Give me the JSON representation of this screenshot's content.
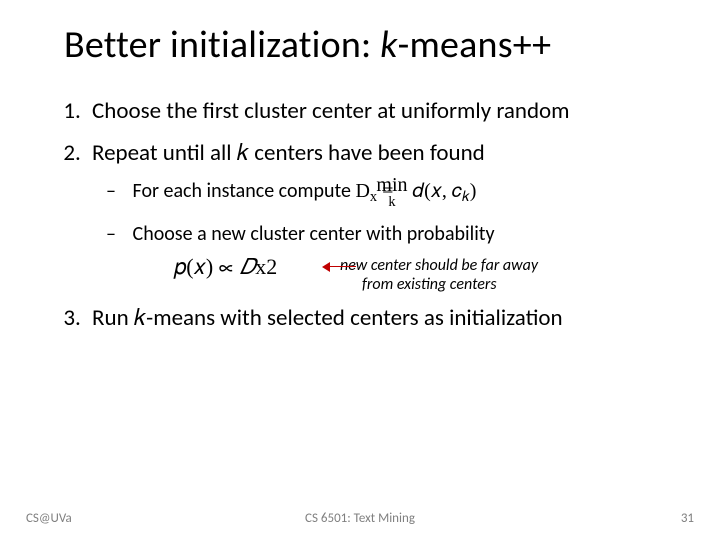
{
  "title_prefix": "Better initialization: ",
  "title_k": "k",
  "title_suffix": "-means++",
  "items": {
    "one": "Choose the first cluster center at uniformly random",
    "two_prefix": "Repeat until all ",
    "two_k": "𝑘",
    "two_suffix": " centers have been found",
    "sub1_prefix": "For each instance compute ",
    "sub1_formula_D": "D",
    "sub1_formula_x": "x",
    "sub1_formula_eq": " = ",
    "sub1_formula_min": "min",
    "sub1_formula_k": "k",
    "sub1_formula_d": " 𝑑(𝑥, 𝑐",
    "sub1_formula_ck": "𝑘",
    "sub1_formula_close": ")",
    "sub2": "Choose a new cluster center with probability",
    "formula_px": "𝑝(𝑥) ∝ ",
    "formula_D": "𝐷",
    "formula_Dx": "x",
    "formula_sq": "2",
    "note_line": "new center should be far away from existing centers",
    "three_prefix": "Run ",
    "three_k": "𝑘",
    "three_suffix": "-means with selected centers as initialization"
  },
  "footer": {
    "left": "CS@UVa",
    "center": "CS 6501: Text Mining",
    "right": "31"
  }
}
